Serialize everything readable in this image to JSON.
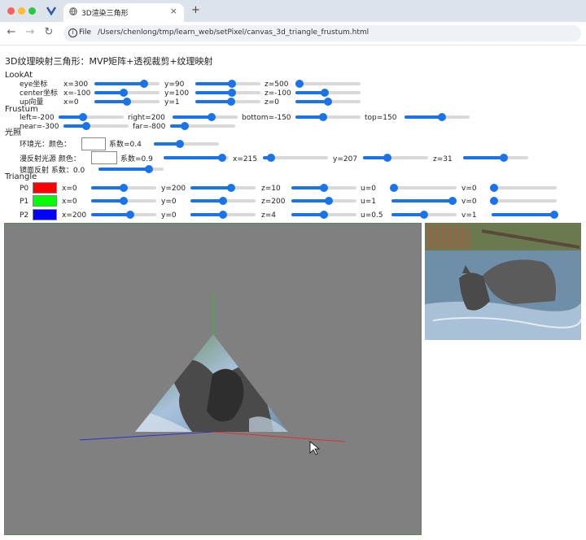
{
  "browser": {
    "tab_title": "3D渲染三角形",
    "file_label": "File",
    "url": "/Users/chenlong/tmp/learn_web/setPixel/canvas_3d_triangle_frustum.html",
    "new_tab": "+",
    "close_tab": "×"
  },
  "page": {
    "title": "3D纹理映射三角形：MVP矩阵+透视裁剪+纹理映射"
  },
  "lookat": {
    "header": "LookAt",
    "eye": {
      "label": "eye坐标",
      "x": {
        "text": "x=300",
        "value": 0.76
      },
      "y": {
        "text": "y=90",
        "value": 0.56
      },
      "z": {
        "text": "z=500",
        "value": 0.06
      }
    },
    "center": {
      "label": "center坐标",
      "x": {
        "text": "x=-100",
        "value": 0.45
      },
      "y": {
        "text": "y=100",
        "value": 0.56
      },
      "z": {
        "text": "z=-100",
        "value": 0.45
      }
    },
    "up": {
      "label": "up向量",
      "x": {
        "text": "x=0",
        "value": 0.5
      },
      "y": {
        "text": "y=1",
        "value": 0.55
      },
      "z": {
        "text": "z=0",
        "value": 0.5
      }
    }
  },
  "frustum": {
    "header": "Frustum",
    "left": {
      "text": "left=-200",
      "value": 0.37
    },
    "right": {
      "text": "right=200",
      "value": 0.6
    },
    "bottom": {
      "text": "bottom=-150",
      "value": 0.43
    },
    "top": {
      "text": "top=150",
      "value": 0.57
    },
    "near": {
      "text": "near=-300",
      "value": 0.35
    },
    "far": {
      "text": "far=-800",
      "value": 0.22
    }
  },
  "lighting": {
    "header": "光照",
    "ambient_label": "环境光：颜色：",
    "ambient_coef": {
      "text": "系数=0.4",
      "value": 0.4
    },
    "diffuse_label": "漫反射光源 颜色：",
    "diffuse_coef": {
      "text": "系数=0.9",
      "value": 0.9
    },
    "diffuse_x": {
      "text": "x=215",
      "value": 0.13
    },
    "diffuse_y": {
      "text": "y=207",
      "value": 0.38
    },
    "diffuse_z": {
      "text": "z=31",
      "value": 0.63
    },
    "specular": {
      "text": "镜面反射 系数：0.0",
      "value": 0.77
    }
  },
  "triangle": {
    "header": "Triangle",
    "points": [
      {
        "name": "P0",
        "color": "#ff0000",
        "x": {
          "text": "x=0",
          "value": 0.5
        },
        "y": {
          "text": "y=200",
          "value": 0.63
        },
        "z": {
          "text": "z=10",
          "value": 0.5
        },
        "u": {
          "text": "u=0",
          "value": 0.04
        },
        "v": {
          "text": "v=0",
          "value": 0.04
        }
      },
      {
        "name": "P1",
        "color": "#00ff00",
        "x": {
          "text": "x=0",
          "value": 0.5
        },
        "y": {
          "text": "y=0",
          "value": 0.5
        },
        "z": {
          "text": "z=200",
          "value": 0.57
        },
        "u": {
          "text": "u=1",
          "value": 0.94
        },
        "v": {
          "text": "v=0",
          "value": 0.04
        }
      },
      {
        "name": "P2",
        "color": "#0000ff",
        "x": {
          "text": "x=200",
          "value": 0.6
        },
        "y": {
          "text": "y=0",
          "value": 0.5
        },
        "z": {
          "text": "z=4",
          "value": 0.5
        },
        "u": {
          "text": "u=0.5",
          "value": 0.5
        },
        "v": {
          "text": "v=1",
          "value": 0.96
        }
      }
    ]
  },
  "colors": {
    "accent": "#1a73e8",
    "canvas_bg": "#808080",
    "axis_x": "#e03030",
    "axis_y": "#30c030",
    "axis_z": "#3030d0"
  }
}
